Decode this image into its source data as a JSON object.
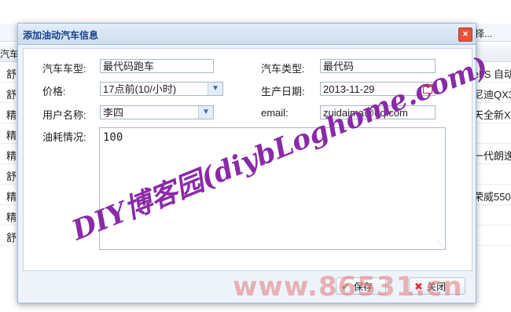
{
  "background": {
    "toolbar_right": "择...",
    "header_label": "汽车",
    "rows": [
      {
        "left": "舒",
        "right": "el S 自动"
      },
      {
        "left": "舒",
        "right": "尼迪QX3"
      },
      {
        "left": "精",
        "right": "天全新X"
      },
      {
        "left": "精",
        "right": ""
      },
      {
        "left": "精",
        "right": "一代朗逸"
      },
      {
        "left": "舒",
        "right": ""
      },
      {
        "left": "精",
        "right": "荣威550"
      },
      {
        "left": "精",
        "right": ""
      },
      {
        "left": "舒",
        "right": ""
      }
    ]
  },
  "dialog": {
    "title": "添加油动汽车信息",
    "close_label": "×",
    "form": {
      "car_model_label": "汽车车型:",
      "car_model_value": "最代码跑车",
      "car_type_label": "汽车类型:",
      "car_type_value": "最代码",
      "price_label": "价格:",
      "price_value": "17点前(10/小时)",
      "production_date_label": "生产日期:",
      "production_date_value": "2013-11-29",
      "username_label": "用户名称:",
      "username_value": "李四",
      "email_label": "email:",
      "email_value": "zuidaima@qq.com",
      "fuel_label": "油耗情况:",
      "fuel_value": "100"
    },
    "buttons": {
      "save_label": "保存",
      "close_label": "关闭"
    }
  },
  "watermarks": {
    "main": "DIY博客园(diybLoghome.com)",
    "bottom": "www.86531.cn"
  },
  "colors": {
    "title_text": "#15428b",
    "dialog_border": "#99bbe8",
    "watermark_main": "#8a2aa8",
    "close_button": "#e5533a",
    "save_icon": "#3aa53a",
    "close_icon": "#d33"
  }
}
